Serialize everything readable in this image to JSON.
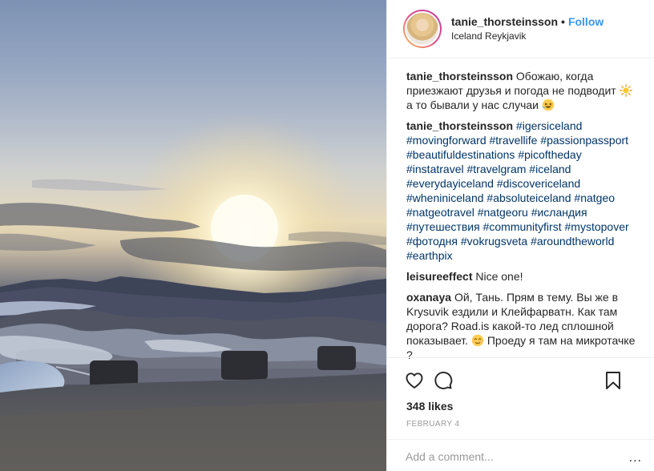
{
  "post": {
    "username": "tanie_thorsteinsson",
    "follow_label": "Follow",
    "location": "Iceland Reykjavik",
    "likes": "348 likes",
    "date": "FEBRUARY 4",
    "add_comment_placeholder": "Add a comment...",
    "more_label": "..."
  },
  "caption": {
    "user": "tanie_thorsteinsson",
    "text_a": "Обожаю, когда приезжают друзья и погода не подводит",
    "emoji_a": "sun-emoji",
    "text_b": "а то бывали у нас случаи",
    "emoji_b": "laughing-emoji"
  },
  "hashtag_comment": {
    "user": "tanie_thorsteinsson",
    "tags": [
      "#igersiceland",
      "#movingforward",
      "#travellife",
      "#passionpassport",
      "#beautifuldestinations",
      "#picoftheday",
      "#instatravel",
      "#travelgram",
      "#iceland",
      "#everydayiceland",
      "#discovericeland",
      "#wheniniceland",
      "#absoluteiceland",
      "#natgeo",
      "#natgeotravel",
      "#natgeoru",
      "#исландия",
      "#путешествия",
      "#communityfirst",
      "#mystopover",
      "#фотодня",
      "#vokrugsveta",
      "#aroundtheworld",
      "#earthpix"
    ]
  },
  "comment_leisure": {
    "user": "leisureeffect",
    "text": "Nice one!"
  },
  "comment_oxanaya": {
    "user": "oxanaya",
    "text_a": "Ой, Тань. Прям в тему. Вы же в Krysuvik ездили и Клейфарватн. Как там дорога? Road.is какой-то лед сплошной показывает.",
    "emoji": "relieved-emoji",
    "text_b": "Проеду я там на микротачке ?"
  },
  "icons": [
    "heart-icon",
    "comment-icon",
    "bookmark-icon",
    "sun-emoji",
    "laughing-emoji",
    "relieved-emoji"
  ],
  "colors": {
    "link": "#3897f0",
    "hashtag": "#003569",
    "text": "#262626",
    "muted": "#999999",
    "border": "#efefef"
  }
}
